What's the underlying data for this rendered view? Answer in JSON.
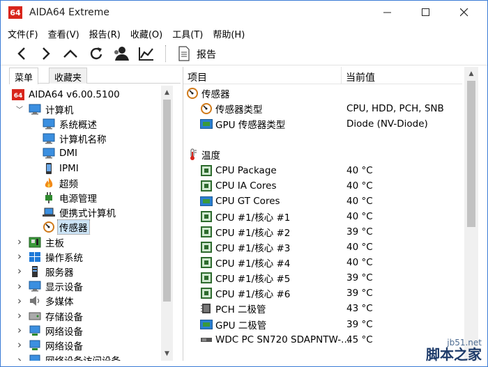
{
  "window": {
    "app_logo": "64",
    "title": "AIDA64 Extreme"
  },
  "window_controls": {
    "minimize": "—",
    "maximize": "☐",
    "close": "✕"
  },
  "menu": [
    "文件(F)",
    "查看(V)",
    "报告(R)",
    "收藏(O)",
    "工具(T)",
    "帮助(H)"
  ],
  "toolbar": {
    "buttons": [
      "back-icon",
      "forward-icon",
      "up-icon",
      "refresh-icon",
      "user-icon",
      "chart-icon"
    ],
    "report_label": "报告"
  },
  "left_tabs": [
    "菜单",
    "收藏夹"
  ],
  "tree": [
    {
      "label": "AIDA64 v6.00.5100",
      "icon": "aida64-logo-icon",
      "level": 0,
      "expander": ""
    },
    {
      "label": "计算机",
      "icon": "computer-icon",
      "level": 0,
      "expander": "v"
    },
    {
      "label": "系统概述",
      "icon": "monitor-icon",
      "level": 1,
      "expander": ""
    },
    {
      "label": "计算机名称",
      "icon": "monitor-icon",
      "level": 1,
      "expander": ""
    },
    {
      "label": "DMI",
      "icon": "monitor-icon",
      "level": 1,
      "expander": ""
    },
    {
      "label": "IPMI",
      "icon": "phone-icon",
      "level": 1,
      "expander": ""
    },
    {
      "label": "超频",
      "icon": "fire-icon",
      "level": 1,
      "expander": ""
    },
    {
      "label": "电源管理",
      "icon": "power-plug-icon",
      "level": 1,
      "expander": ""
    },
    {
      "label": "便携式计算机",
      "icon": "laptop-icon",
      "level": 1,
      "expander": ""
    },
    {
      "label": "传感器",
      "icon": "gauge-icon",
      "level": 1,
      "expander": "",
      "selected": true
    },
    {
      "label": "主板",
      "icon": "motherboard-icon",
      "level": 0,
      "expander": ">"
    },
    {
      "label": "操作系统",
      "icon": "windows-icon",
      "level": 0,
      "expander": ">"
    },
    {
      "label": "服务器",
      "icon": "server-icon",
      "level": 0,
      "expander": ">"
    },
    {
      "label": "显示设备",
      "icon": "display-icon",
      "level": 0,
      "expander": ">"
    },
    {
      "label": "多媒体",
      "icon": "speaker-icon",
      "level": 0,
      "expander": ">"
    },
    {
      "label": "存储设备",
      "icon": "drive-icon",
      "level": 0,
      "expander": ">"
    },
    {
      "label": "网络设备",
      "icon": "network-icon",
      "level": 0,
      "expander": ">"
    },
    {
      "label": "网络设备",
      "icon": "network-icon",
      "level": 0,
      "expander": ">"
    },
    {
      "label": "网络设备访问设备",
      "icon": "network-icon",
      "level": 0,
      "expander": ">"
    }
  ],
  "right_header": {
    "col1": "项目",
    "col2": "当前值"
  },
  "rows": [
    {
      "kind": "group",
      "label": "传感器",
      "value": "",
      "icon": "gauge-icon"
    },
    {
      "kind": "item",
      "label": "传感器类型",
      "value": "CPU, HDD, PCH, SNB",
      "icon": "gauge-icon"
    },
    {
      "kind": "item",
      "label": "GPU 传感器类型",
      "value": "Diode  (NV-Diode)",
      "icon": "gpu-icon"
    },
    {
      "kind": "spacer",
      "label": "",
      "value": "",
      "icon": ""
    },
    {
      "kind": "group",
      "label": "温度",
      "value": "",
      "icon": "thermometer-icon"
    },
    {
      "kind": "item",
      "label": "CPU Package",
      "value": "40 °C",
      "icon": "chip-icon"
    },
    {
      "kind": "item",
      "label": "CPU IA Cores",
      "value": "40 °C",
      "icon": "chip-icon"
    },
    {
      "kind": "item",
      "label": "CPU GT Cores",
      "value": "40 °C",
      "icon": "gpu-icon"
    },
    {
      "kind": "item",
      "label": "CPU #1/核心 #1",
      "value": "40 °C",
      "icon": "chip-icon"
    },
    {
      "kind": "item",
      "label": "CPU #1/核心 #2",
      "value": "39 °C",
      "icon": "chip-icon"
    },
    {
      "kind": "item",
      "label": "CPU #1/核心 #3",
      "value": "40 °C",
      "icon": "chip-icon"
    },
    {
      "kind": "item",
      "label": "CPU #1/核心 #4",
      "value": "40 °C",
      "icon": "chip-icon"
    },
    {
      "kind": "item",
      "label": "CPU #1/核心 #5",
      "value": "39 °C",
      "icon": "chip-icon"
    },
    {
      "kind": "item",
      "label": "CPU #1/核心 #6",
      "value": "39 °C",
      "icon": "chip-icon"
    },
    {
      "kind": "item",
      "label": "PCH 二极管",
      "value": "43 °C",
      "icon": "pch-icon"
    },
    {
      "kind": "item",
      "label": "GPU 二极管",
      "value": "39 °C",
      "icon": "gpu-icon"
    },
    {
      "kind": "item",
      "label": "WDC PC SN720 SDAPNTW-...",
      "value": "45 °C",
      "icon": "ssd-icon"
    }
  ],
  "watermark": {
    "site": "jb51.net",
    "text": "脚本之家"
  },
  "colors": {
    "accent": "#3a7bd5",
    "selection": "#cce4f7",
    "logo_red": "#d8261c"
  }
}
